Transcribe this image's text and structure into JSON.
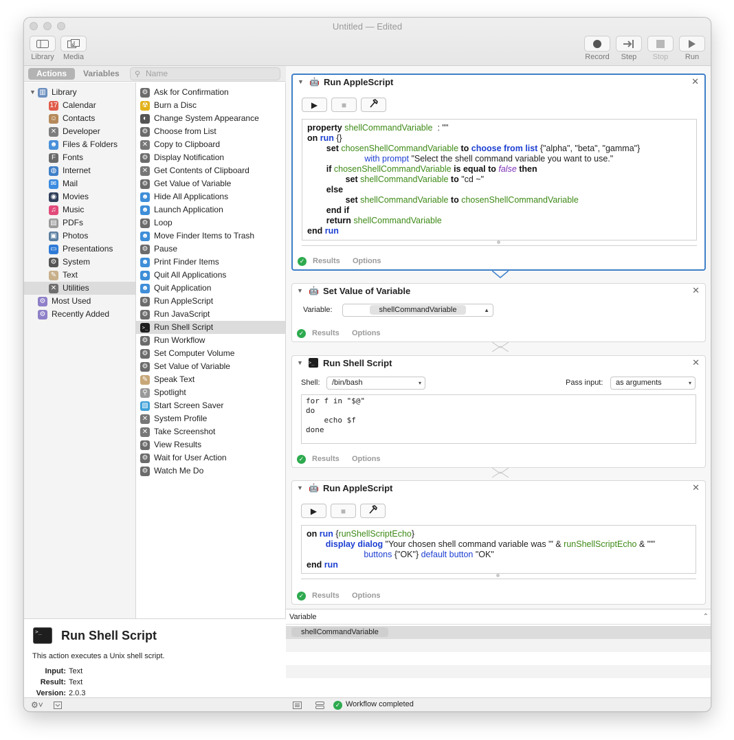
{
  "window": {
    "title": "Untitled — Edited"
  },
  "toolbar": {
    "left": [
      {
        "name": "library-button",
        "label": "Library",
        "icon": "sidebar-icon"
      },
      {
        "name": "media-button",
        "label": "Media",
        "icon": "media-icon"
      }
    ],
    "right": [
      {
        "name": "record-button",
        "label": "Record",
        "icon": "record-icon",
        "enabled": true
      },
      {
        "name": "step-button",
        "label": "Step",
        "icon": "step-icon",
        "enabled": true
      },
      {
        "name": "stop-button",
        "label": "Stop",
        "icon": "stop-icon",
        "enabled": false
      },
      {
        "name": "run-button",
        "label": "Run",
        "icon": "run-icon",
        "enabled": true
      }
    ]
  },
  "sidebar": {
    "tabs": {
      "actions": "Actions",
      "variables": "Variables"
    },
    "search_placeholder": "Name",
    "library": [
      {
        "label": "Library",
        "icon": "library-icon",
        "color": "#6c8fbf",
        "level": 0,
        "expanded": true
      },
      {
        "label": "Calendar",
        "icon": "calendar-icon",
        "color": "#e05c4a",
        "level": 1
      },
      {
        "label": "Contacts",
        "icon": "contacts-icon",
        "color": "#b5895a",
        "level": 1
      },
      {
        "label": "Developer",
        "icon": "developer-icon",
        "color": "#7d7d7d",
        "level": 1
      },
      {
        "label": "Files & Folders",
        "icon": "finder-icon",
        "color": "#4a90d9",
        "level": 1
      },
      {
        "label": "Fonts",
        "icon": "fonts-icon",
        "color": "#6a6a6a",
        "level": 1
      },
      {
        "label": "Internet",
        "icon": "internet-icon",
        "color": "#3f7fc8",
        "level": 1
      },
      {
        "label": "Mail",
        "icon": "mail-icon",
        "color": "#3b8be0",
        "level": 1
      },
      {
        "label": "Movies",
        "icon": "movies-icon",
        "color": "#2f3f5a",
        "level": 1
      },
      {
        "label": "Music",
        "icon": "music-icon",
        "color": "#e24a7a",
        "level": 1
      },
      {
        "label": "PDFs",
        "icon": "pdf-icon",
        "color": "#9a9a9a",
        "level": 1
      },
      {
        "label": "Photos",
        "icon": "photos-icon",
        "color": "#5a7ea0",
        "level": 1
      },
      {
        "label": "Presentations",
        "icon": "presentations-icon",
        "color": "#2f7ad6",
        "level": 1
      },
      {
        "label": "System",
        "icon": "system-icon",
        "color": "#555555",
        "level": 1
      },
      {
        "label": "Text",
        "icon": "text-icon",
        "color": "#c8b08a",
        "level": 1
      },
      {
        "label": "Utilities",
        "icon": "utilities-icon",
        "color": "#6f6f6f",
        "level": 1,
        "selected": true
      },
      {
        "label": "Most Used",
        "icon": "smart-folder-icon",
        "color": "#8e7fc8",
        "level": 0
      },
      {
        "label": "Recently Added",
        "icon": "smart-folder-icon",
        "color": "#8e7fc8",
        "level": 0
      }
    ],
    "actions": [
      {
        "label": "Ask for Confirmation",
        "icon": "automator-icon"
      },
      {
        "label": "Burn a Disc",
        "icon": "burn-icon"
      },
      {
        "label": "Change System Appearance",
        "icon": "appearance-icon"
      },
      {
        "label": "Choose from List",
        "icon": "automator-icon"
      },
      {
        "label": "Copy to Clipboard",
        "icon": "tools-icon"
      },
      {
        "label": "Display Notification",
        "icon": "automator-icon"
      },
      {
        "label": "Get Contents of Clipboard",
        "icon": "tools-icon"
      },
      {
        "label": "Get Value of Variable",
        "icon": "automator-icon"
      },
      {
        "label": "Hide All Applications",
        "icon": "finder-icon"
      },
      {
        "label": "Launch Application",
        "icon": "finder-icon"
      },
      {
        "label": "Loop",
        "icon": "automator-icon"
      },
      {
        "label": "Move Finder Items to Trash",
        "icon": "finder-icon"
      },
      {
        "label": "Pause",
        "icon": "automator-icon"
      },
      {
        "label": "Print Finder Items",
        "icon": "finder-icon"
      },
      {
        "label": "Quit All Applications",
        "icon": "finder-icon"
      },
      {
        "label": "Quit Application",
        "icon": "finder-icon"
      },
      {
        "label": "Run AppleScript",
        "icon": "automator-icon"
      },
      {
        "label": "Run JavaScript",
        "icon": "automator-icon"
      },
      {
        "label": "Run Shell Script",
        "icon": "terminal-icon",
        "selected": true
      },
      {
        "label": "Run Workflow",
        "icon": "automator-icon"
      },
      {
        "label": "Set Computer Volume",
        "icon": "automator-icon"
      },
      {
        "label": "Set Value of Variable",
        "icon": "automator-icon"
      },
      {
        "label": "Speak Text",
        "icon": "speak-icon"
      },
      {
        "label": "Spotlight",
        "icon": "spotlight-icon"
      },
      {
        "label": "Start Screen Saver",
        "icon": "screensaver-icon"
      },
      {
        "label": "System Profile",
        "icon": "tools-icon"
      },
      {
        "label": "Take Screenshot",
        "icon": "tools-icon"
      },
      {
        "label": "View Results",
        "icon": "automator-icon"
      },
      {
        "label": "Wait for User Action",
        "icon": "automator-icon"
      },
      {
        "label": "Watch Me Do",
        "icon": "automator-icon"
      }
    ]
  },
  "description": {
    "title": "Run Shell Script",
    "text": "This action executes a Unix shell script.",
    "input_label": "Input:",
    "input": "Text",
    "result_label": "Result:",
    "result": "Text",
    "version_label": "Version:",
    "version": "2.0.3"
  },
  "workflow": {
    "footer": {
      "results": "Results",
      "options": "Options"
    },
    "applescript1": {
      "title": "Run AppleScript",
      "lines": [
        [
          [
            "kw",
            "property "
          ],
          [
            "gr",
            "shellCommandVariable"
          ],
          [
            "",
            "  : \"\""
          ]
        ],
        [
          [
            "kw",
            "on "
          ],
          [
            "blb",
            "run"
          ],
          [
            "",
            " {}"
          ]
        ],
        [
          [
            "",
            "        "
          ],
          [
            "kw",
            "set "
          ],
          [
            "gr",
            "chosenShellCommandVariable"
          ],
          [
            "kw",
            " to "
          ],
          [
            "blb",
            "choose from list"
          ],
          [
            "",
            " {\"alpha\", \"beta\", \"gamma\"}"
          ]
        ],
        [
          [
            "",
            "                        "
          ],
          [
            "bl",
            "with prompt"
          ],
          [
            "",
            " \"Select the shell command variable you want to use.\""
          ]
        ],
        [
          [
            "",
            "        "
          ],
          [
            "kw",
            "if "
          ],
          [
            "gr",
            "chosenShellCommandVariable"
          ],
          [
            "kw",
            " is equal to "
          ],
          [
            "pu",
            "false"
          ],
          [
            "kw",
            " then"
          ]
        ],
        [
          [
            "",
            "                "
          ],
          [
            "kw",
            "set "
          ],
          [
            "gr",
            "shellCommandVariable"
          ],
          [
            "kw",
            " to "
          ],
          [
            "",
            "\"cd ~\""
          ]
        ],
        [
          [
            "",
            "        "
          ],
          [
            "kw",
            "else"
          ]
        ],
        [
          [
            "",
            "                "
          ],
          [
            "kw",
            "set "
          ],
          [
            "gr",
            "shellCommandVariable"
          ],
          [
            "kw",
            " to "
          ],
          [
            "gr",
            "chosenShellCommandVariable"
          ]
        ],
        [
          [
            "",
            "        "
          ],
          [
            "kw",
            "end if"
          ]
        ],
        [
          [
            "",
            "        "
          ],
          [
            "kw",
            "return "
          ],
          [
            "gr",
            "shellCommandVariable"
          ]
        ],
        [
          [
            "kw",
            "end "
          ],
          [
            "blb",
            "run"
          ]
        ]
      ]
    },
    "setvar": {
      "title": "Set Value of Variable",
      "variable_label": "Variable:",
      "variable_value": "shellCommandVariable"
    },
    "shell": {
      "title": "Run Shell Script",
      "shell_label": "Shell:",
      "shell_value": "/bin/bash",
      "pass_label": "Pass input:",
      "pass_value": "as arguments",
      "script": "for f in \"$@\"\ndo\n    echo $f\ndone"
    },
    "applescript2": {
      "title": "Run AppleScript",
      "lines": [
        [
          [
            "kw",
            "on "
          ],
          [
            "blb",
            "run"
          ],
          [
            "",
            " {"
          ],
          [
            "gr",
            "runShellScriptEcho"
          ],
          [
            "",
            "}"
          ]
        ],
        [
          [
            "",
            "        "
          ],
          [
            "blb",
            "display dialog"
          ],
          [
            "",
            " \"Your chosen shell command variable was '\" & "
          ],
          [
            "gr",
            "runShellScriptEcho"
          ],
          [
            "",
            " & \"'\""
          ]
        ],
        [
          [
            "",
            "                        "
          ],
          [
            "bl",
            "buttons"
          ],
          [
            "",
            " {\"OK\"} "
          ],
          [
            "bl",
            "default button"
          ],
          [
            "",
            " \"OK\""
          ]
        ],
        [
          [
            "kw",
            "end "
          ],
          [
            "blb",
            "run"
          ]
        ]
      ]
    }
  },
  "variables_pane": {
    "header": "Variable",
    "items": [
      "shellCommandVariable"
    ]
  },
  "statusbar": {
    "status": "Workflow completed"
  }
}
